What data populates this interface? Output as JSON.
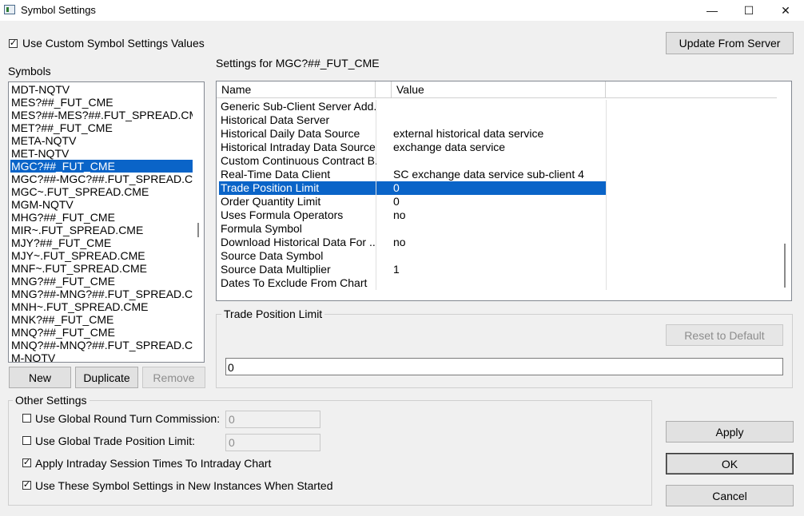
{
  "window": {
    "title": "Symbol Settings",
    "minimize": "—",
    "maximize": "☐",
    "close": "✕"
  },
  "use_custom": {
    "checked": "✓",
    "label": "Use Custom Symbol Settings Values"
  },
  "update_button": "Update From Server",
  "symbols_label": "Symbols",
  "symbols": [
    "MDT-NQTV",
    "MES?##_FUT_CME",
    "MES?##-MES?##.FUT_SPREAD.CME",
    "MET?##_FUT_CME",
    "META-NQTV",
    "MET-NQTV",
    "MGC?##_FUT_CME",
    "MGC?##-MGC?##.FUT_SPREAD.CME",
    "MGC~.FUT_SPREAD.CME",
    "MGM-NQTV",
    "MHG?##_FUT_CME",
    "MIR~.FUT_SPREAD.CME",
    "MJY?##_FUT_CME",
    "MJY~.FUT_SPREAD.CME",
    "MNF~.FUT_SPREAD.CME",
    "MNG?##_FUT_CME",
    "MNG?##-MNG?##.FUT_SPREAD.CME",
    "MNH~.FUT_SPREAD.CME",
    "MNK?##_FUT_CME",
    "MNQ?##_FUT_CME",
    "MNQ?##-MNQ?##.FUT_SPREAD.CME",
    "M-NQTV"
  ],
  "selected_symbol_index": 6,
  "list_buttons": {
    "new": "New",
    "duplicate": "Duplicate",
    "remove": "Remove"
  },
  "settings_for_label": "Settings for MGC?##_FUT_CME",
  "grid": {
    "headers": {
      "name": "Name",
      "value": "Value"
    },
    "rows": [
      {
        "name": "Generic Sub-Client Server Add...",
        "value": ""
      },
      {
        "name": "Historical Data Server",
        "value": ""
      },
      {
        "name": "Historical Daily Data Source",
        "value": "external historical data service"
      },
      {
        "name": "Historical Intraday Data Source",
        "value": "exchange data service"
      },
      {
        "name": "Custom Continuous Contract B...",
        "value": ""
      },
      {
        "name": "Real-Time Data Client",
        "value": "SC exchange data service sub-client 4"
      },
      {
        "name": "Trade Position Limit",
        "value": "0"
      },
      {
        "name": "Order Quantity Limit",
        "value": "0"
      },
      {
        "name": "Uses Formula Operators",
        "value": "no"
      },
      {
        "name": "Formula Symbol",
        "value": ""
      },
      {
        "name": "Download Historical Data For ...",
        "value": "no"
      },
      {
        "name": "Source Data Symbol",
        "value": ""
      },
      {
        "name": "Source Data Multiplier",
        "value": "1"
      },
      {
        "name": "Dates To Exclude From Chart",
        "value": ""
      }
    ],
    "selected_row_index": 6
  },
  "detail": {
    "title": "Trade Position Limit",
    "reset_button": "Reset to Default",
    "value": "0"
  },
  "other_settings": {
    "title": "Other Settings",
    "round_turn": {
      "checked": "",
      "label": "Use Global Round Turn Commission:",
      "value": "0"
    },
    "trade_limit": {
      "checked": "",
      "label": "Use Global Trade Position Limit:",
      "value": "0"
    },
    "intraday": {
      "checked": "✓",
      "label": "Apply Intraday Session Times To Intraday Chart"
    },
    "new_instances": {
      "checked": "✓",
      "label": "Use These Symbol Settings in New Instances When Started"
    }
  },
  "dialog_buttons": {
    "apply": "Apply",
    "ok": "OK",
    "cancel": "Cancel"
  }
}
